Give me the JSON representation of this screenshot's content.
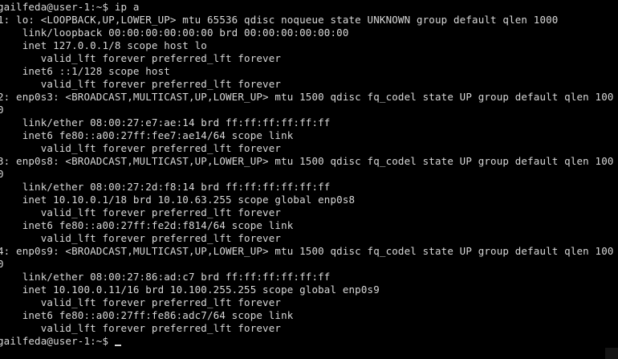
{
  "terminal": {
    "lines": [
      "gailfeda@user-1:~$ ip a",
      "1: lo: <LOOPBACK,UP,LOWER_UP> mtu 65536 qdisc noqueue state UNKNOWN group default qlen 1000",
      "    link/loopback 00:00:00:00:00:00 brd 00:00:00:00:00:00",
      "    inet 127.0.0.1/8 scope host lo",
      "       valid_lft forever preferred_lft forever",
      "    inet6 ::1/128 scope host",
      "       valid_lft forever preferred_lft forever",
      "2: enp0s3: <BROADCAST,MULTICAST,UP,LOWER_UP> mtu 1500 qdisc fq_codel state UP group default qlen 100",
      "0",
      "    link/ether 08:00:27:e7:ae:14 brd ff:ff:ff:ff:ff:ff",
      "    inet6 fe80::a00:27ff:fee7:ae14/64 scope link",
      "       valid_lft forever preferred_lft forever",
      "3: enp0s8: <BROADCAST,MULTICAST,UP,LOWER_UP> mtu 1500 qdisc fq_codel state UP group default qlen 100",
      "0",
      "    link/ether 08:00:27:2d:f8:14 brd ff:ff:ff:ff:ff:ff",
      "    inet 10.10.0.1/18 brd 10.10.63.255 scope global enp0s8",
      "       valid_lft forever preferred_lft forever",
      "    inet6 fe80::a00:27ff:fe2d:f814/64 scope link",
      "       valid_lft forever preferred_lft forever",
      "4: enp0s9: <BROADCAST,MULTICAST,UP,LOWER_UP> mtu 1500 qdisc fq_codel state UP group default qlen 100",
      "0",
      "    link/ether 08:00:27:86:ad:c7 brd ff:ff:ff:ff:ff:ff",
      "    inet 10.100.0.11/16 brd 10.100.255.255 scope global enp0s9",
      "       valid_lft forever preferred_lft forever",
      "    inet6 fe80::a00:27ff:fe86:adc7/64 scope link",
      "       valid_lft forever preferred_lft forever"
    ],
    "prompt": "gailfeda@user-1:~$ ",
    "colors": {
      "background": "#000000",
      "foreground": "#d8d8d8"
    }
  }
}
